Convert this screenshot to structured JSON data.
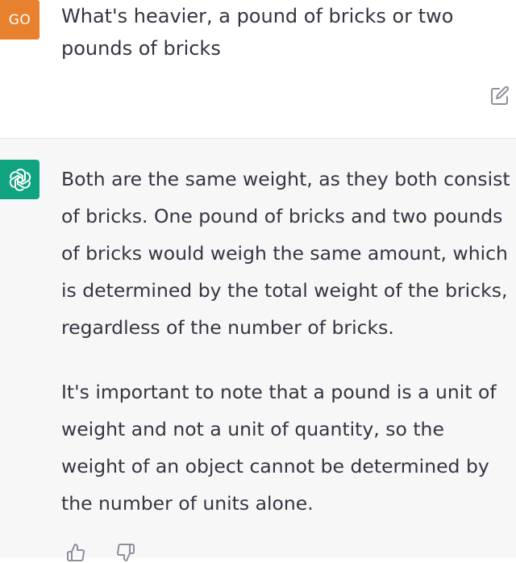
{
  "user_message": {
    "avatar_initials": "GO",
    "text": "What's heavier, a pound of bricks or two pounds of bricks",
    "edit_icon": "edit-icon",
    "avatar_color": "#e8812e"
  },
  "assistant_message": {
    "avatar_icon": "openai-logo-icon",
    "avatar_color": "#10a37f",
    "paragraphs": [
      "Both are the same weight, as they both consist of bricks. One pound of bricks and two pounds of bricks would weigh the same amount, which is determined by the total weight of the bricks, regardless of the number of bricks.",
      "It's important to note that a pound is a unit of weight and not a unit of quantity, so the weight of an object cannot be determined by the number of units alone."
    ],
    "lines_p1": [
      "Both are the same weight, as they both consist",
      "of bricks. One pound of bricks and two pounds",
      "of bricks would weigh the same amount, which",
      "is determined by the total weight of the bricks,",
      "regardless of the number of bricks."
    ],
    "lines_p2": [
      "It's important to note that a pound is a unit of",
      "weight and not a unit of quantity, so the",
      "weight of an object cannot be determined by",
      "the number of units alone."
    ],
    "actions": [
      "thumbs-up-icon",
      "thumbs-down-icon"
    ]
  }
}
